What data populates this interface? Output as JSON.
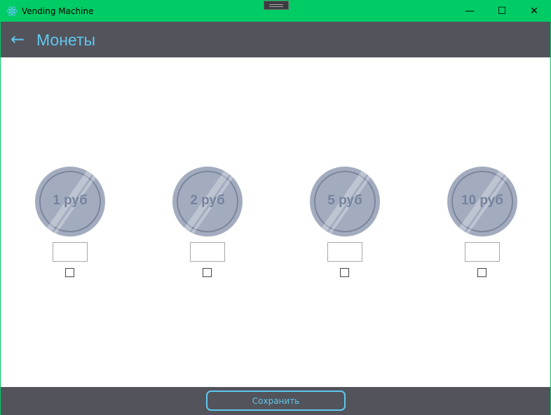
{
  "window": {
    "title": "Vending Machine",
    "minimize": "—",
    "maximize": "☐",
    "close": "✕"
  },
  "header": {
    "back_icon": "arrow-left-icon",
    "title": "Монеты"
  },
  "coins": [
    {
      "label": "1 руб",
      "quantity": "",
      "checked": false
    },
    {
      "label": "2 руб",
      "quantity": "",
      "checked": false
    },
    {
      "label": "5 руб",
      "quantity": "",
      "checked": false
    },
    {
      "label": "10 руб",
      "quantity": "",
      "checked": false
    }
  ],
  "footer": {
    "save_label": "Сохранить"
  },
  "colors": {
    "titlebar": "#00cc66",
    "header": "#53535c",
    "accent": "#5ec8ee",
    "coin": "#a3acbf"
  }
}
